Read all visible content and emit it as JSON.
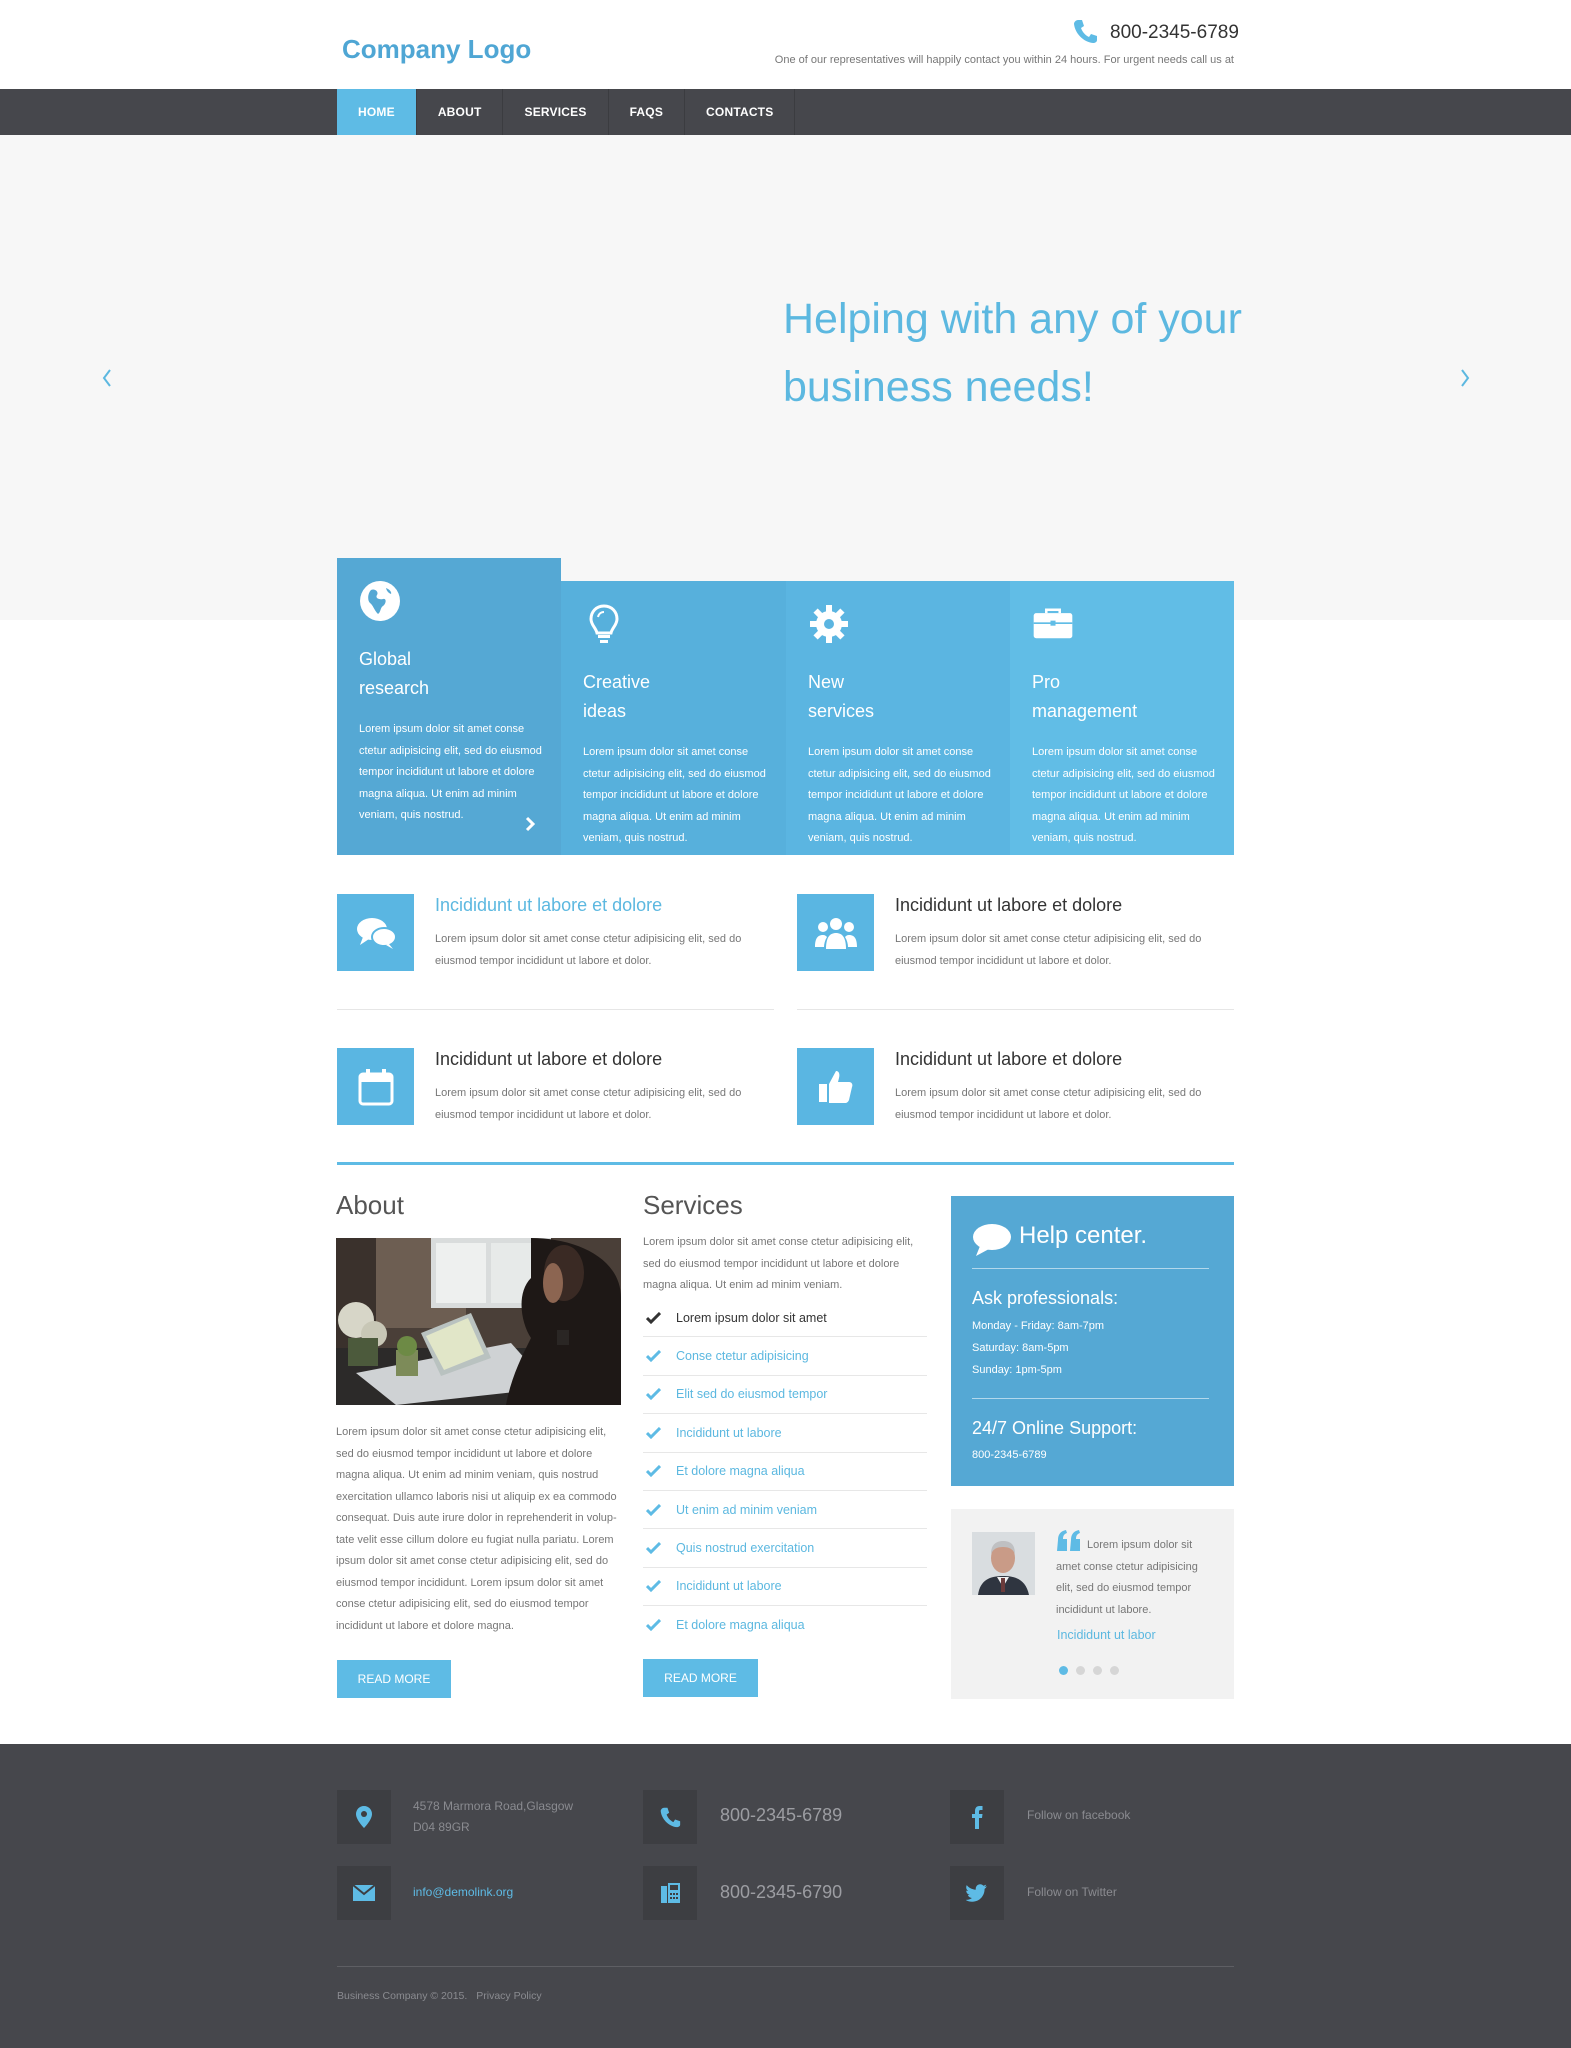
{
  "header": {
    "logo": "Company Logo",
    "phone": "800-2345-6789",
    "note": "One of our representatives will happily contact you within 24 hours. For urgent needs call us at"
  },
  "nav": {
    "items": [
      {
        "label": "HOME",
        "active": true
      },
      {
        "label": "ABOUT",
        "active": false
      },
      {
        "label": "SERVICES",
        "active": false
      },
      {
        "label": "FAQS",
        "active": false
      },
      {
        "label": "CONTACTS",
        "active": false
      }
    ]
  },
  "hero": {
    "line1": "Helping with any of your",
    "line2": "business needs!"
  },
  "tiles": [
    {
      "icon": "globe-icon",
      "title_line1": "Global",
      "title_line2": "research",
      "text": "Lorem ipsum dolor sit amet conse ctetur adipisicing elit, sed do eiusmod tempor incididunt ut labore et dolore magna aliqua. Ut enim ad minim veniam, quis nostrud."
    },
    {
      "icon": "lightbulb-icon",
      "title_line1": "Creative",
      "title_line2": "ideas",
      "text": "Lorem ipsum dolor sit amet conse ctetur adipisicing elit, sed do eiusmod tempor incididunt ut labore et dolore magna aliqua. Ut enim ad minim veniam, quis nostrud."
    },
    {
      "icon": "gear-icon",
      "title_line1": "New",
      "title_line2": "services",
      "text": "Lorem ipsum dolor sit amet conse ctetur adipisicing elit, sed do eiusmod tempor incididunt ut labore et dolore magna aliqua. Ut enim ad minim veniam, quis nostrud."
    },
    {
      "icon": "briefcase-icon",
      "title_line1": "Pro",
      "title_line2": "management",
      "text": "Lorem ipsum dolor sit amet conse ctetur adipisicing elit, sed do eiusmod tempor incididunt ut labore et dolore magna aliqua. Ut enim ad minim veniam, quis nostrud."
    }
  ],
  "benefits": [
    {
      "icon": "chat-bubbles-icon",
      "title": "Incididunt ut labore et dolore",
      "text": "Lorem ipsum dolor sit amet conse ctetur adipisicing elit, sed do eiusmod tempor incididunt ut labore et dolor."
    },
    {
      "icon": "users-icon",
      "title": "Incididunt ut labore et dolore",
      "text": "Lorem ipsum dolor sit amet conse ctetur adipisicing elit, sed do eiusmod tempor incididunt ut labore et dolor."
    },
    {
      "icon": "calendar-icon",
      "title": "Incididunt ut labore et dolore",
      "text": "Lorem ipsum dolor sit amet conse ctetur adipisicing elit, sed do eiusmod tempor incididunt ut labore et dolor."
    },
    {
      "icon": "thumbs-up-icon",
      "title": "Incididunt ut labore et dolore",
      "text": "Lorem ipsum dolor sit amet conse ctetur adipisicing elit, sed do eiusmod tempor incididunt ut labore et dolor."
    }
  ],
  "about": {
    "heading": "About",
    "text": "Lorem ipsum dolor sit amet conse ctetur adipisicing elit, sed do eiusmod tempor incididunt ut labore et dolore magna aliqua. Ut enim ad minim veniam, quis nostrud exercitation ullamco laboris nisi ut aliquip ex ea commodo consequat. Duis aute irure dolor in reprehenderit in volup-tate velit esse cillum dolore eu fugiat nulla pariatu. Lorem ipsum dolor sit amet conse ctetur adipisicing elit, sed do eiusmod tempor incididunt. Lorem ipsum dolor sit amet conse ctetur adipisicing elit, sed do eiusmod tempor incididunt ut labore et dolore magna.",
    "button": "READ MORE"
  },
  "services": {
    "heading": "Services",
    "intro": "Lorem ipsum dolor sit amet conse ctetur adipisicing elit, sed do eiusmod tempor incididunt ut labore et dolore magna aliqua. Ut enim ad minim veniam.",
    "items": [
      "Lorem ipsum dolor sit amet",
      "Conse ctetur adipisicing",
      "Elit sed do eiusmod tempor",
      "Incididunt ut labore",
      "Et dolore magna aliqua",
      "Ut enim ad minim veniam",
      "Quis nostrud exercitation",
      "Incididunt ut labore",
      "Et dolore magna aliqua"
    ],
    "button": "READ MORE"
  },
  "help": {
    "title": "Help center.",
    "ask": "Ask professionals:",
    "hours": [
      "Monday - Friday: 8am-7pm",
      "Saturday: 8am-5pm",
      "Sunday: 1pm-5pm"
    ],
    "support": "24/7 Online Support:",
    "support_phone": "800-2345-6789"
  },
  "testimonial": {
    "text": "Lorem ipsum dolor sit amet conse ctetur adipisicing elit, sed do eiusmod tempor incididunt ut labore.",
    "name": "Incididunt ut labor",
    "active_dot": 1,
    "dots": 4
  },
  "footer": {
    "address_line1": "4578 Marmora Road,Glasgow",
    "address_line2": "D04 89GR",
    "phone": "800-2345-6789",
    "facebook": "Follow on facebook",
    "email": "info@demolink.org",
    "fax": "800-2345-6790",
    "twitter": "Follow on Twitter",
    "copyright": "Business Company © 2015.",
    "privacy": "Privacy Policy"
  },
  "colors": {
    "accent": "#5ebbe5",
    "dark": "#46474c"
  }
}
